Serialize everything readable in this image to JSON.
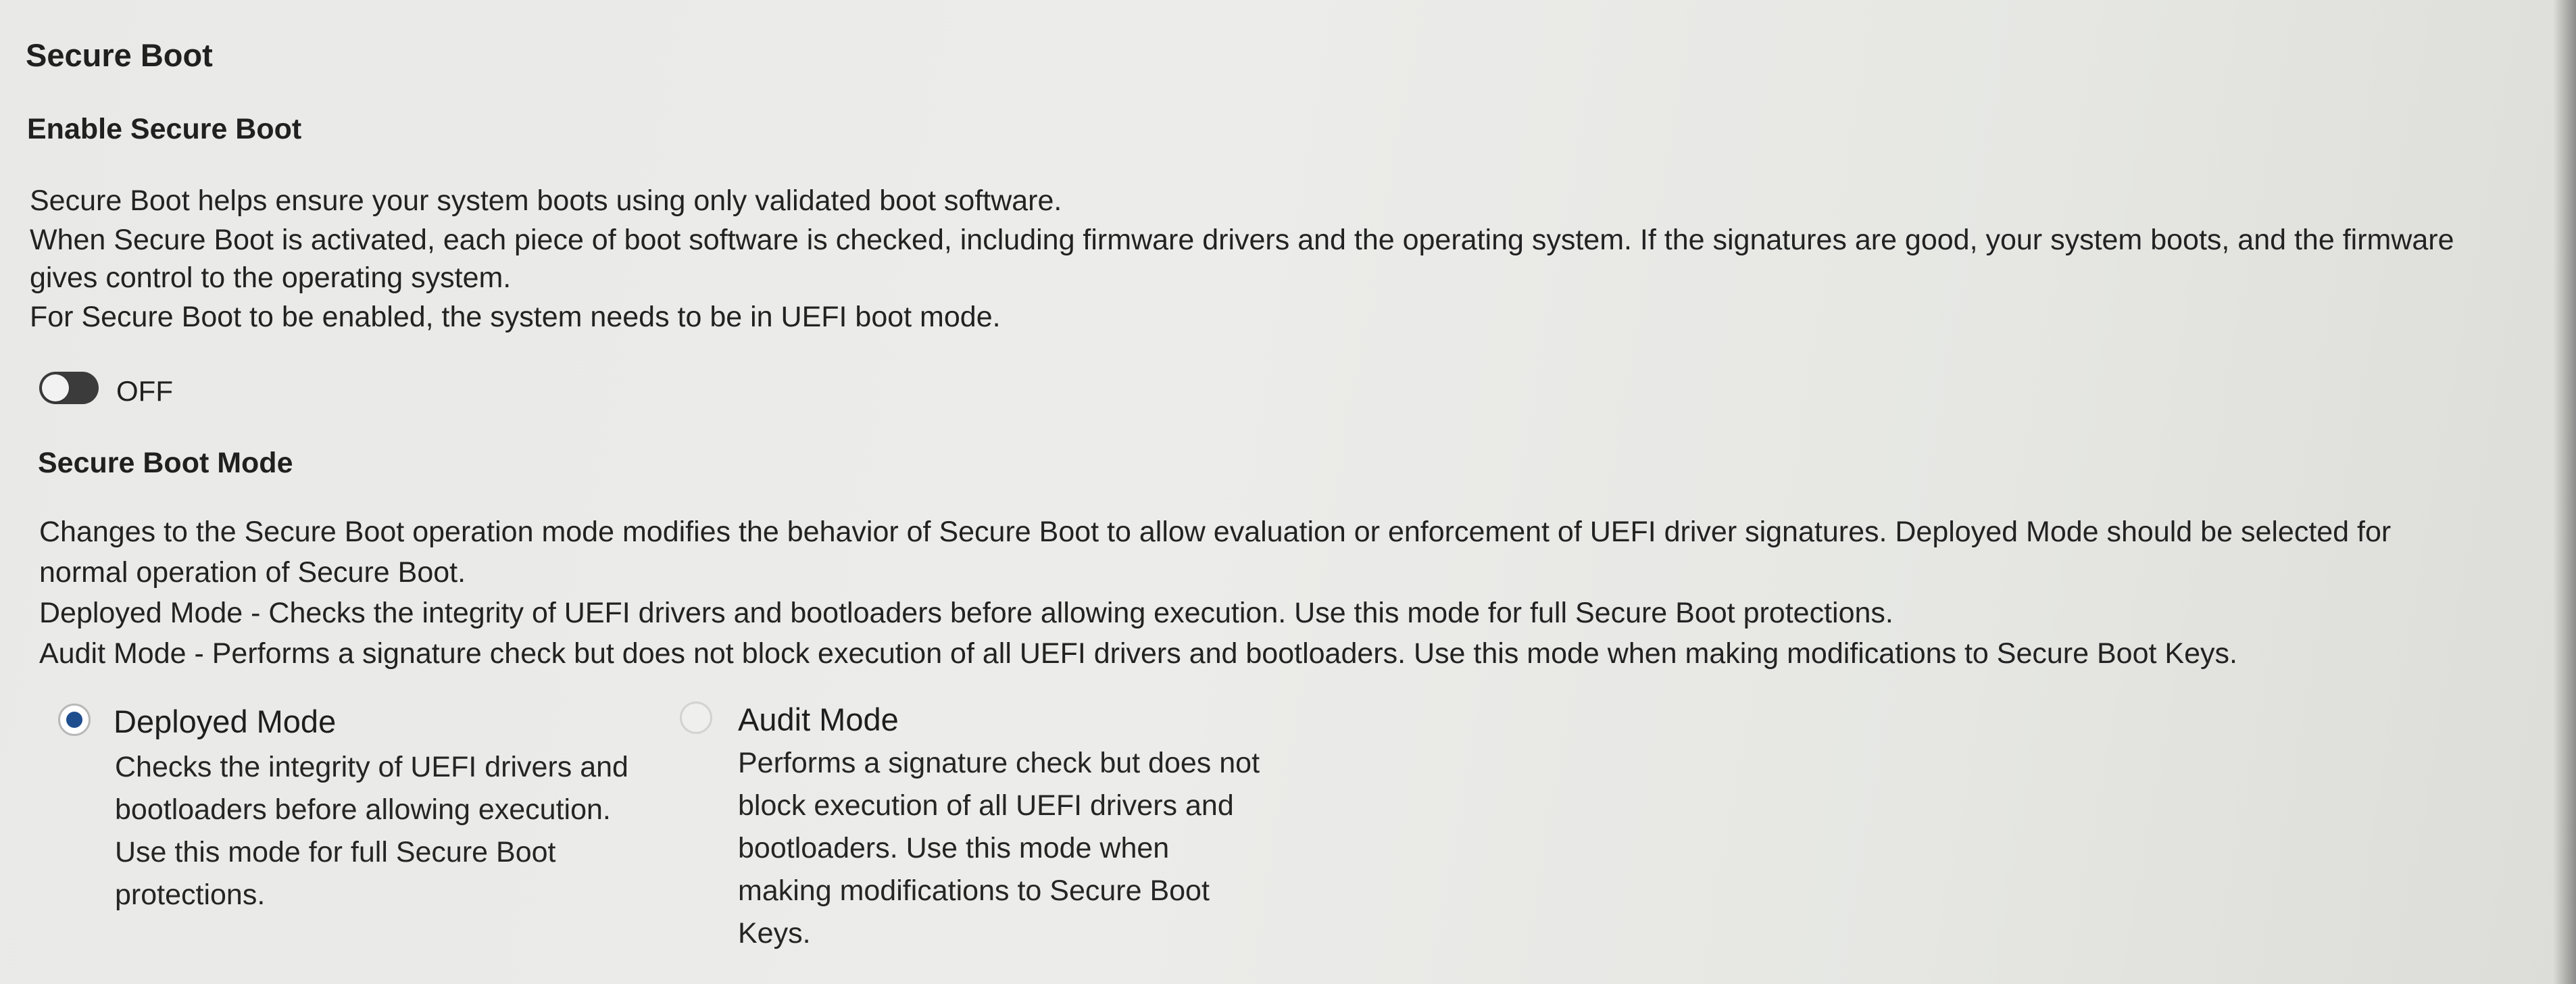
{
  "section": {
    "title": "Secure Boot"
  },
  "enable": {
    "heading": "Enable Secure Boot",
    "description": [
      "Secure Boot helps ensure your system boots using only validated boot software.",
      "When Secure Boot is activated, each piece of boot software is checked, including firmware drivers and the operating system. If the signatures are good, your system boots, and the firmware",
      "gives control to the operating system.",
      "For Secure Boot to be enabled, the system needs to be in UEFI boot mode."
    ],
    "toggle_state": "OFF",
    "toggle_on": false
  },
  "mode": {
    "heading": "Secure Boot Mode",
    "description": [
      "Changes to the Secure Boot operation mode modifies the behavior of Secure Boot to allow evaluation or enforcement of UEFI driver signatures. Deployed Mode should be selected for",
      "normal operation of Secure Boot.",
      "Deployed Mode - Checks the integrity of UEFI drivers and bootloaders before allowing execution. Use this mode for full Secure Boot protections.",
      "Audit Mode - Performs a signature check but does not block execution of all UEFI drivers and bootloaders.  Use this mode when making modifications to Secure Boot Keys."
    ],
    "options": [
      {
        "label": "Deployed Mode",
        "selected": true,
        "description": [
          "Checks the integrity of UEFI drivers and",
          "bootloaders before allowing execution.",
          "Use this mode for full Secure Boot",
          "protections."
        ]
      },
      {
        "label": "Audit Mode",
        "selected": false,
        "description": [
          "Performs a signature check but does not",
          "block execution of all UEFI drivers and",
          "bootloaders.  Use this mode when",
          "making modifications to Secure Boot",
          "Keys."
        ]
      }
    ]
  },
  "colors": {
    "radio_selected": "#1f4e8f",
    "toggle_off": "#3b3b3b"
  }
}
